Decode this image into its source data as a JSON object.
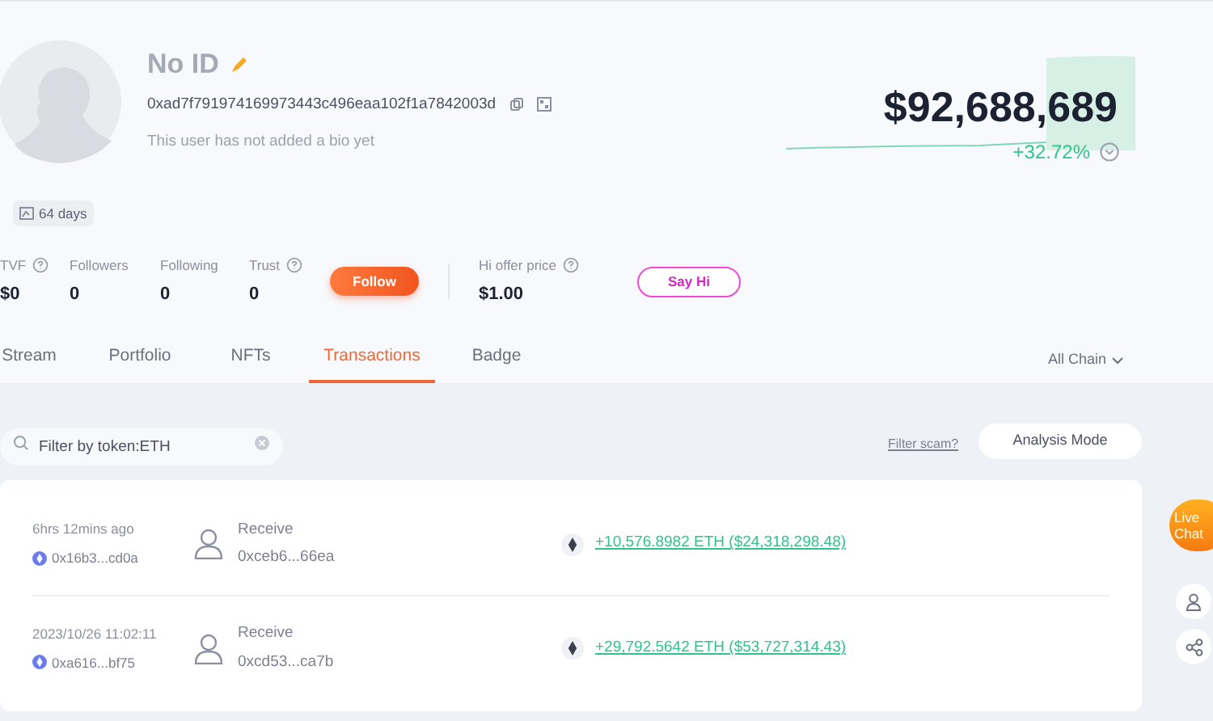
{
  "profile": {
    "name": "No ID",
    "address": "0xad7f791974169973443c496eaa102f1a7842003d",
    "bio": "This user has not added a bio yet",
    "age": "64 days"
  },
  "stats": [
    {
      "label": "TVF",
      "value": "$0",
      "help": true
    },
    {
      "label": "Followers",
      "value": "0",
      "help": false
    },
    {
      "label": "Following",
      "value": "0",
      "help": false
    },
    {
      "label": "Trust",
      "value": "0",
      "help": true
    }
  ],
  "follow_button": "Follow",
  "hi_offer": {
    "label": "Hi offer price",
    "value": "$1.00"
  },
  "say_hi_button": "Say Hi",
  "net_worth": {
    "value": "$92,688,689",
    "change": "+32.72%"
  },
  "tabs": [
    {
      "label": "Stream",
      "selected": false
    },
    {
      "label": "Portfolio",
      "selected": false
    },
    {
      "label": "NFTs",
      "selected": false
    },
    {
      "label": "Transactions",
      "selected": true
    },
    {
      "label": "Badge",
      "selected": false
    }
  ],
  "chain_filter": "All Chain",
  "search": {
    "value": "Filter by token:ETH"
  },
  "filter_scam_link": "Filter scam?",
  "analysis_mode_button": "Analysis Mode",
  "transactions": [
    {
      "time": "6hrs 12mins ago",
      "hash": "0x16b3...cd0a",
      "type": "Receive",
      "counterparty": "0xceb6...66ea",
      "amount": "+10,576.8982 ETH ($24,318,298.48)"
    },
    {
      "time": "2023/10/26 11:02:11",
      "hash": "0xa616...bf75",
      "type": "Receive",
      "counterparty": "0xcd53...ca7b",
      "amount": "+29,792.5642 ETH ($53,727,314.43)"
    }
  ],
  "live_chat_button": "Live Chat"
}
